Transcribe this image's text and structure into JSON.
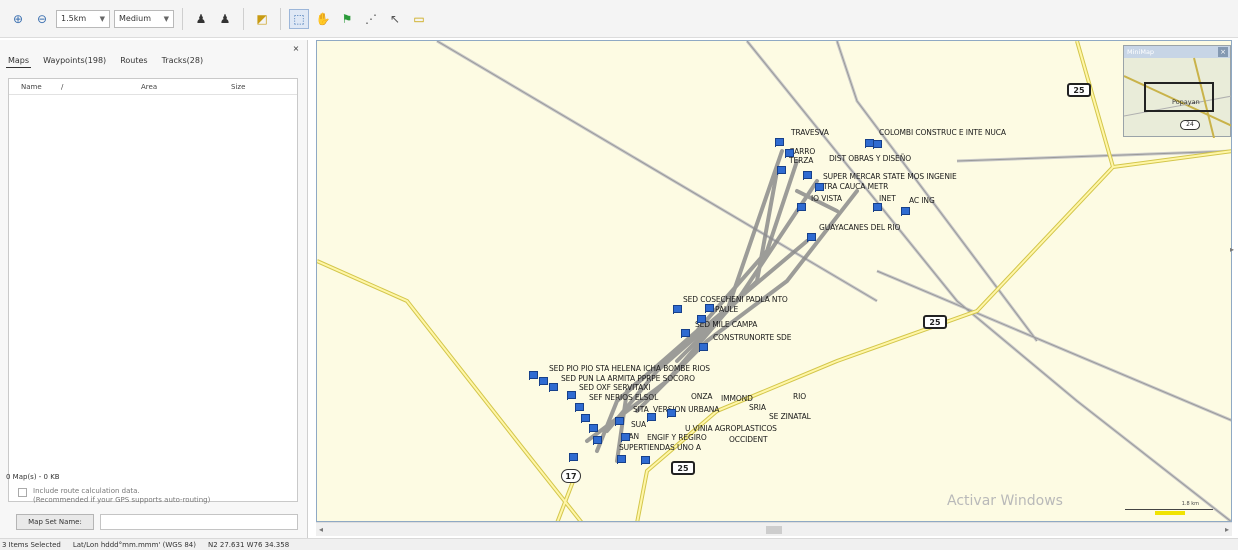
{
  "toolbar": {
    "distance": "1.5km",
    "detail": "Medium",
    "icons": [
      "zoom-in-icon",
      "zoom-out-icon",
      "send-to-device-icon",
      "receive-from-device-icon",
      "map-tool-icon",
      "select-tool-icon",
      "hand-tool-icon",
      "waypoint-tool-icon",
      "route-tool-icon",
      "pointer-tool-icon",
      "measure-tool-icon"
    ]
  },
  "left_panel": {
    "close_glyph": "×",
    "tabs": [
      "Maps",
      "Waypoints(198)",
      "Routes",
      "Tracks(28)"
    ],
    "columns": [
      "Name",
      "/",
      "Area",
      "Size"
    ],
    "maps_count": "0 Map(s) - 0 KB",
    "include_route_line1": "Include route calculation data.",
    "include_route_line2": "(Recommended if your GPS supports auto-routing)",
    "map_set_button": "Map Set Name:",
    "map_set_value": ""
  },
  "map": {
    "background": "#fdfbe3",
    "road_color": "#e6d86a",
    "shields": [
      "25",
      "25",
      "25",
      "17"
    ],
    "labels": [
      "TRAVESVA",
      "COLOMBI CONSTRUC E INTE NUCA",
      "CARRO",
      "TERZA",
      "DIST OBRAS Y DISEÑO",
      "SUPER MERCAR STATE MOS INGENIE",
      "TRA CAUCA METR",
      "IO VISTA",
      "INET",
      "AC ING",
      "GUAYACANES DEL RIO",
      "SED COSECHENI PADLA NTO",
      "PAULE",
      "SED MILE CAMPA",
      "CONSTRUNORTE SDE",
      "SED PIO PIO STA HELENA ICHA BOMBE RIOS",
      "SED PUN LA ARMITA PPRPE SOCORO",
      "SED OXF SERVITAXI",
      "SEF NERIOS ELSOL",
      "ONZA",
      "IMMOND",
      "RIO",
      "SITA",
      "VERSION URBANA",
      "SRIA",
      "SE ZINATAL",
      "SUA",
      "U VINIA AGROPLASTICOS",
      "NAN",
      "ENGIF Y REGIRO",
      "OCCIDENT",
      "SUPERTIENDAS UNO A"
    ],
    "watermark": "Activar Windows",
    "scale_label": "1.8 km"
  },
  "minimap": {
    "title": "MiniMap",
    "close_glyph": "×",
    "city": "Popayan",
    "shield": "24"
  },
  "statusbar": {
    "selected": "3 Items Selected",
    "format": "Lat/Lon hddd°mm.mmm' (WGS 84)",
    "coords": "N2 27.631 W76 34.358"
  }
}
